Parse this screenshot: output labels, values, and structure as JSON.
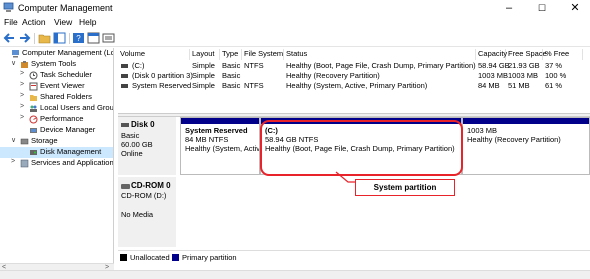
{
  "window": {
    "title": "Computer Management",
    "minimize": "–",
    "maximize": "☐",
    "close": "✕"
  },
  "menu": [
    "File",
    "Action",
    "View",
    "Help"
  ],
  "tree": [
    {
      "label": "Computer Management (Local",
      "indent": 0,
      "arrow": "",
      "icon": "computer-icon",
      "selected": false
    },
    {
      "label": "System Tools",
      "indent": 1,
      "arrow": "∨",
      "icon": "tools-icon",
      "selected": false
    },
    {
      "label": "Task Scheduler",
      "indent": 2,
      "arrow": ">",
      "icon": "clock-icon",
      "selected": false
    },
    {
      "label": "Event Viewer",
      "indent": 2,
      "arrow": ">",
      "icon": "event-log-icon",
      "selected": false
    },
    {
      "label": "Shared Folders",
      "indent": 2,
      "arrow": ">",
      "icon": "shared-folder-icon",
      "selected": false
    },
    {
      "label": "Local Users and Groups",
      "indent": 2,
      "arrow": ">",
      "icon": "users-icon",
      "selected": false
    },
    {
      "label": "Performance",
      "indent": 2,
      "arrow": ">",
      "icon": "performance-icon",
      "selected": false
    },
    {
      "label": "Device Manager",
      "indent": 2,
      "arrow": "",
      "icon": "device-manager-icon",
      "selected": false
    },
    {
      "label": "Storage",
      "indent": 1,
      "arrow": "∨",
      "icon": "storage-icon",
      "selected": false
    },
    {
      "label": "Disk Management",
      "indent": 2,
      "arrow": "",
      "icon": "disk-management-icon",
      "selected": true
    },
    {
      "label": "Services and Applications",
      "indent": 1,
      "arrow": ">",
      "icon": "services-icon",
      "selected": false
    }
  ],
  "volume_table": {
    "headers": [
      "Volume",
      "Layout",
      "Type",
      "File System",
      "Status",
      "Capacity",
      "Free Space",
      "% Free"
    ],
    "rows": [
      [
        "(C:)",
        "Simple",
        "Basic",
        "NTFS",
        "Healthy (Boot, Page File, Crash Dump, Primary Partition)",
        "58.94 GB",
        "21.93 GB",
        "37 %"
      ],
      [
        "(Disk 0 partition 3)",
        "Simple",
        "Basic",
        "",
        "Healthy (Recovery Partition)",
        "1003 MB",
        "1003 MB",
        "100 %"
      ],
      [
        "System Reserved",
        "Simple",
        "Basic",
        "NTFS",
        "Healthy (System, Active, Primary Partition)",
        "84 MB",
        "51 MB",
        "61 %"
      ]
    ]
  },
  "disk0": {
    "name": "Disk 0",
    "type": "Basic",
    "size": "60.00 GB",
    "state": "Online",
    "partitions": [
      {
        "name": "System Reserved",
        "size": "84 MB NTFS",
        "status": "Healthy (System, Activ"
      },
      {
        "name": "(C:)",
        "size": "58.94 GB NTFS",
        "status": "Healthy (Boot, Page File, Crash Dump, Primary Partition)"
      },
      {
        "name": "",
        "size": "1003 MB",
        "status": "Healthy (Recovery Partition)"
      }
    ]
  },
  "cdrom0": {
    "name": "CD-ROM 0",
    "drive": "CD-ROM (D:)",
    "media": "No Media"
  },
  "legend": {
    "unallocated": "Unallocated",
    "primary": "Primary partition"
  },
  "annotation": {
    "label": "System partition"
  },
  "colors": {
    "primary_partition": "#00008b",
    "unallocated": "#000000",
    "highlight": "#e8232a",
    "selection": "#cce8ff"
  }
}
